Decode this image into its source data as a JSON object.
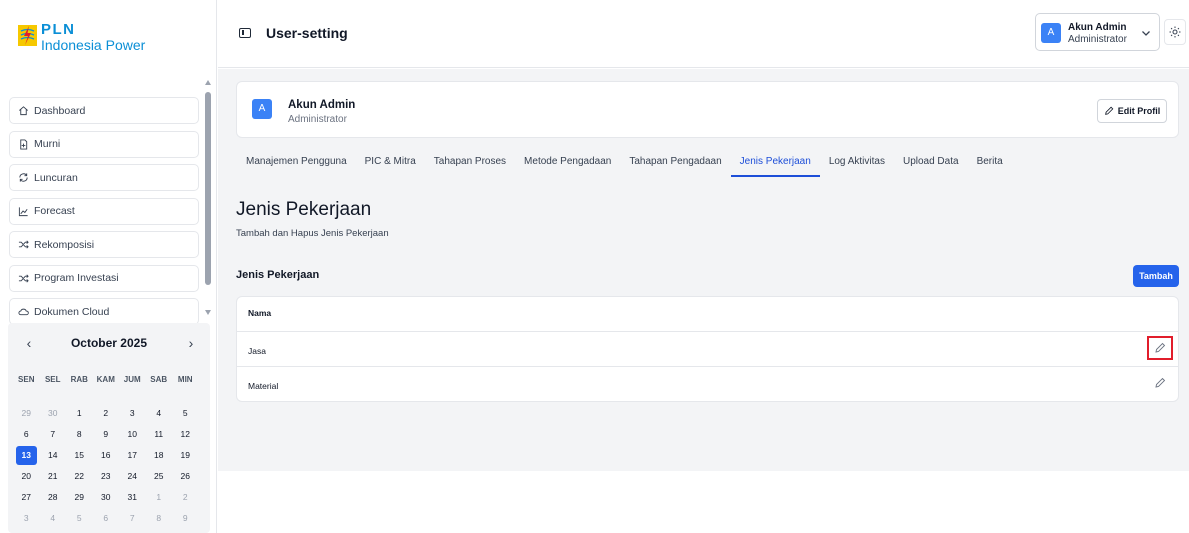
{
  "brand": {
    "name": "PLN",
    "subtitle": "Indonesia Power"
  },
  "sidebar": {
    "items": [
      {
        "label": "Dashboard",
        "icon": "home-icon"
      },
      {
        "label": "Murni",
        "icon": "file-icon"
      },
      {
        "label": "Luncuran",
        "icon": "refresh-icon"
      },
      {
        "label": "Forecast",
        "icon": "trend-icon"
      },
      {
        "label": "Rekomposisi",
        "icon": "shuffle-icon"
      },
      {
        "label": "Program Investasi",
        "icon": "shuffle-icon"
      },
      {
        "label": "Dokumen Cloud",
        "icon": "cloud-icon"
      }
    ]
  },
  "calendar": {
    "title": "October 2025",
    "prev": "‹",
    "next": "›",
    "weekdays": [
      "SEN",
      "SEL",
      "RAB",
      "KAM",
      "JUM",
      "SAB",
      "MIN"
    ],
    "days": [
      {
        "d": "29",
        "m": true
      },
      {
        "d": "30",
        "m": true
      },
      {
        "d": "1"
      },
      {
        "d": "2"
      },
      {
        "d": "3"
      },
      {
        "d": "4"
      },
      {
        "d": "5"
      },
      {
        "d": "6"
      },
      {
        "d": "7"
      },
      {
        "d": "8"
      },
      {
        "d": "9"
      },
      {
        "d": "10"
      },
      {
        "d": "11"
      },
      {
        "d": "12"
      },
      {
        "d": "13",
        "t": true
      },
      {
        "d": "14"
      },
      {
        "d": "15"
      },
      {
        "d": "16"
      },
      {
        "d": "17"
      },
      {
        "d": "18"
      },
      {
        "d": "19"
      },
      {
        "d": "20"
      },
      {
        "d": "21"
      },
      {
        "d": "22"
      },
      {
        "d": "23"
      },
      {
        "d": "24"
      },
      {
        "d": "25"
      },
      {
        "d": "26"
      },
      {
        "d": "27"
      },
      {
        "d": "28"
      },
      {
        "d": "29"
      },
      {
        "d": "30"
      },
      {
        "d": "31"
      },
      {
        "d": "1",
        "m": true
      },
      {
        "d": "2",
        "m": true
      },
      {
        "d": "3",
        "m": true
      },
      {
        "d": "4",
        "m": true
      },
      {
        "d": "5",
        "m": true
      },
      {
        "d": "6",
        "m": true
      },
      {
        "d": "7",
        "m": true
      },
      {
        "d": "8",
        "m": true
      },
      {
        "d": "9",
        "m": true
      }
    ]
  },
  "header": {
    "title": "User-setting",
    "user": {
      "initial": "A",
      "name": "Akun Admin",
      "role": "Administrator"
    }
  },
  "profile": {
    "initial": "A",
    "name": "Akun Admin",
    "role": "Administrator",
    "edit_label": "Edit Profil"
  },
  "tabs": [
    {
      "label": "Manajemen Pengguna"
    },
    {
      "label": "PIC & Mitra"
    },
    {
      "label": "Tahapan Proses"
    },
    {
      "label": "Metode Pengadaan"
    },
    {
      "label": "Tahapan Pengadaan"
    },
    {
      "label": "Jenis Pekerjaan",
      "active": true
    },
    {
      "label": "Log Aktivitas"
    },
    {
      "label": "Upload Data"
    },
    {
      "label": "Berita"
    }
  ],
  "section": {
    "title": "Jenis Pekerjaan",
    "subtitle": "Tambah dan Hapus Jenis Pekerjaan",
    "list_title": "Jenis Pekerjaan",
    "add_label": "Tambah"
  },
  "table": {
    "header": "Nama",
    "rows": [
      {
        "name": "Jasa"
      },
      {
        "name": "Material"
      }
    ]
  },
  "colors": {
    "accent": "#2563eb",
    "highlight": "#e11d2b",
    "brand": "#0b8fd6"
  }
}
